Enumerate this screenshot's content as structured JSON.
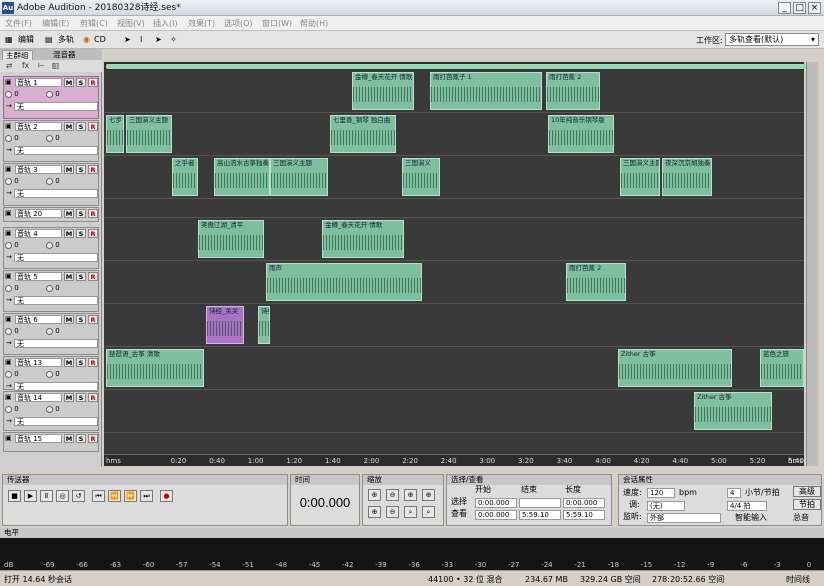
{
  "window": {
    "title": "Adobe Audition - 20180328诗经.ses*",
    "app_icon": "Au",
    "min": "_",
    "max": "□",
    "close": "×"
  },
  "menu": [
    "文件(F)",
    "编辑(E)",
    "剪辑(C)",
    "视图(V)",
    "插入(I)",
    "效果(T)",
    "选项(O)",
    "窗口(W)",
    "帮助(H)"
  ],
  "toolbar": {
    "edit": "编辑",
    "multitrack": "多轨",
    "cd": "CD",
    "workspace_label": "工作区:",
    "workspace_value": "多轨查看(默认)"
  },
  "left_panel": {
    "tab_main": "主群组",
    "tab_mixer": "混音器",
    "icons": "fx"
  },
  "tracks": [
    {
      "name": "音轨 1",
      "vol": "0",
      "pan": "0",
      "out": "无"
    },
    {
      "name": "音轨 2",
      "vol": "0",
      "pan": "0",
      "out": "无"
    },
    {
      "name": "音轨 3",
      "vol": "0",
      "pan": "0",
      "out": "无"
    },
    {
      "name": "音轨 20",
      "vol": "",
      "pan": "",
      "out": ""
    },
    {
      "name": "音轨 4",
      "vol": "0",
      "pan": "0",
      "out": "无"
    },
    {
      "name": "音轨 5",
      "vol": "0",
      "pan": "0",
      "out": "无"
    },
    {
      "name": "音轨 6",
      "vol": "0",
      "pan": "0",
      "out": "无"
    },
    {
      "name": "音轨 13",
      "vol": "0",
      "pan": "0",
      "out": "无"
    },
    {
      "name": "音轨 14",
      "vol": "0",
      "pan": "0",
      "out": "无"
    },
    {
      "name": "音轨 15",
      "vol": "0",
      "pan": "0",
      "out": "无"
    }
  ],
  "track_buttons": {
    "m": "M",
    "s": "S",
    "r": "R"
  },
  "clips": [
    {
      "lane": 0,
      "label": "金樽_春天花开 情歌",
      "color": "green"
    },
    {
      "lane": 0,
      "label": "雨打芭蕉子 1",
      "color": "green"
    },
    {
      "lane": 0,
      "label": "雨打芭蕉 2",
      "color": "green"
    },
    {
      "lane": 1,
      "label": "七步",
      "color": "green"
    },
    {
      "lane": 1,
      "label": "三国演义主题",
      "color": "green"
    },
    {
      "lane": 1,
      "label": "七里香_钢琴 独白曲",
      "color": "green"
    },
    {
      "lane": 1,
      "label": "10年纯音乐钢琴版",
      "color": "green"
    },
    {
      "lane": 2,
      "label": "之乎者",
      "color": "green"
    },
    {
      "lane": 2,
      "label": "高山流水古筝独奏",
      "color": "green"
    },
    {
      "lane": 2,
      "label": "三国演义主题",
      "color": "green"
    },
    {
      "lane": 2,
      "label": "三国演义",
      "color": "green"
    },
    {
      "lane": 2,
      "label": "三国演义主题",
      "color": "green"
    },
    {
      "lane": 2,
      "label": "夜深沉京胡独奏",
      "color": "green"
    },
    {
      "lane": 4,
      "label": "笑傲江湖_清平",
      "color": "green"
    },
    {
      "lane": 4,
      "label": "金樽_春天花开 情歌",
      "color": "green"
    },
    {
      "lane": 5,
      "label": "雨声",
      "color": "green"
    },
    {
      "lane": 5,
      "label": "雨打芭蕉 2",
      "color": "green"
    },
    {
      "lane": 6,
      "label": "诗经_关关",
      "color": "purple"
    },
    {
      "lane": 6,
      "label": "诗经",
      "color": "green"
    },
    {
      "lane": 7,
      "label": "琵琶语_古筝 清歌",
      "color": "green"
    },
    {
      "lane": 7,
      "label": "Zither 古筝",
      "color": "green"
    },
    {
      "lane": 7,
      "label": "蓝色之旅",
      "color": "green"
    },
    {
      "lane": 8,
      "label": "Zither 古筝",
      "color": "green"
    }
  ],
  "ruler": [
    "hms",
    "0:20",
    "0:40",
    "1:00",
    "1:20",
    "1:40",
    "2:00",
    "2:20",
    "2:40",
    "3:00",
    "3:20",
    "3:40",
    "4:00",
    "4:20",
    "4:40",
    "5:00",
    "5:20",
    "5:40",
    "hms"
  ],
  "transport": {
    "title": "传送器",
    "time_title": "时间",
    "time": "0:00.000",
    "zoom_title": "缩放"
  },
  "selection": {
    "title": "选择/查看",
    "start": "开始",
    "end": "结束",
    "length": "长度",
    "sel": "选择",
    "view": "查看",
    "sel_start": "0:00.000",
    "sel_end": "",
    "sel_len": "0:00.000",
    "view_start": "0:00.000",
    "view_end": "5:59.10",
    "view_len": "5:59.10"
  },
  "session": {
    "title": "会话属性",
    "tempo_label": "速度:",
    "tempo": "120",
    "bpm": "bpm",
    "beats": "4",
    "beats_label": "小节/节拍",
    "key_label": "调:",
    "key": "(无)",
    "time_sig": "4/4 拍",
    "monitor_label": "监听:",
    "monitor": "外部",
    "smart": "智能输入",
    "advanced": "高级",
    "metronome": "节拍",
    "total": "总音"
  },
  "level": {
    "title": "电平",
    "scale": [
      "dB",
      "-69",
      "-66",
      "-63",
      "-60",
      "-57",
      "-54",
      "-51",
      "-48",
      "-45",
      "-42",
      "-39",
      "-36",
      "-33",
      "-30",
      "-27",
      "-24",
      "-21",
      "-18",
      "-15",
      "-12",
      "-9",
      "-6",
      "-3",
      "0"
    ]
  },
  "status": {
    "left": "打开 14.64 秒会话",
    "rate": "44100 • 32 位 混合",
    "mem": "234.67 MB",
    "disk": "329.24 GB 空间",
    "time_free": "278:20:52.66 空间",
    "mode": "时间线"
  }
}
